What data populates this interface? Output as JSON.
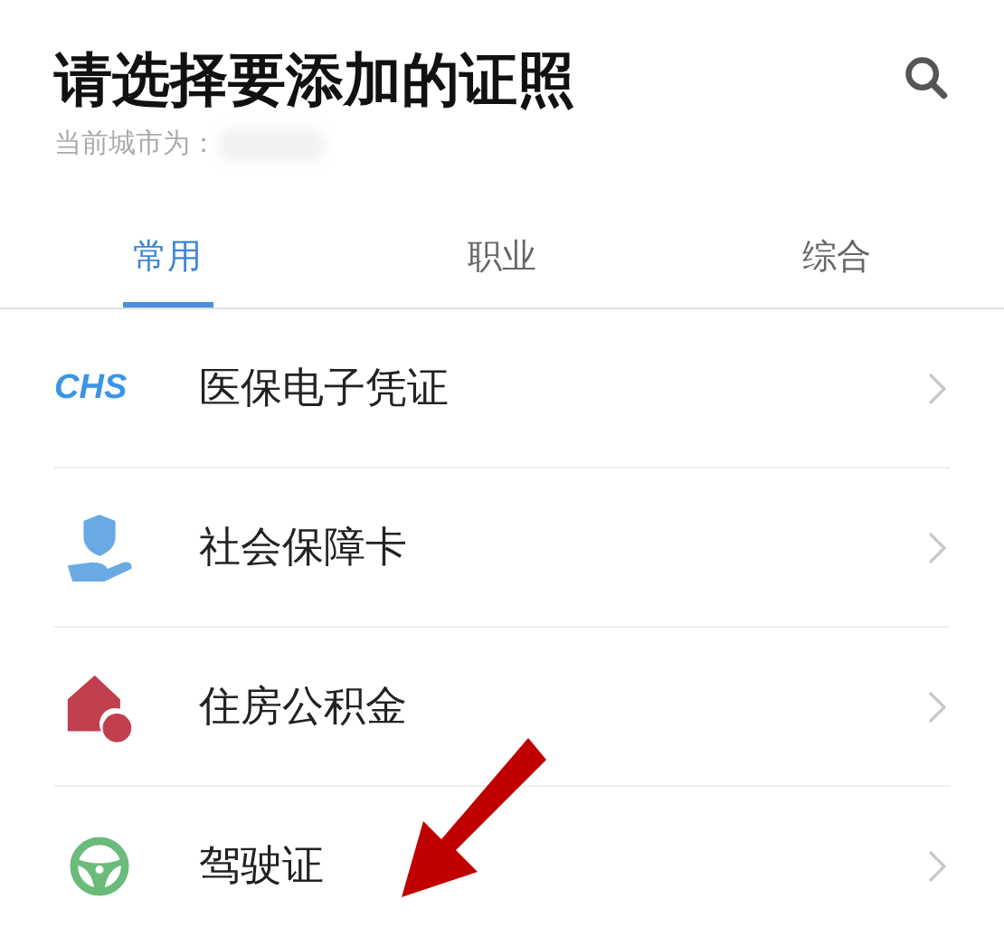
{
  "header": {
    "title": "请选择要添加的证照",
    "city_label": "当前城市为："
  },
  "tabs": [
    {
      "label": "常用",
      "selected": true
    },
    {
      "label": "职业",
      "selected": false
    },
    {
      "label": "综合",
      "selected": false
    }
  ],
  "items": [
    {
      "kind": "chs",
      "logo": "CHS",
      "label": "医保电子凭证"
    },
    {
      "kind": "social",
      "label": "社会保障卡"
    },
    {
      "kind": "housing",
      "label": "住房公积金"
    },
    {
      "kind": "driving",
      "label": "驾驶证"
    }
  ]
}
